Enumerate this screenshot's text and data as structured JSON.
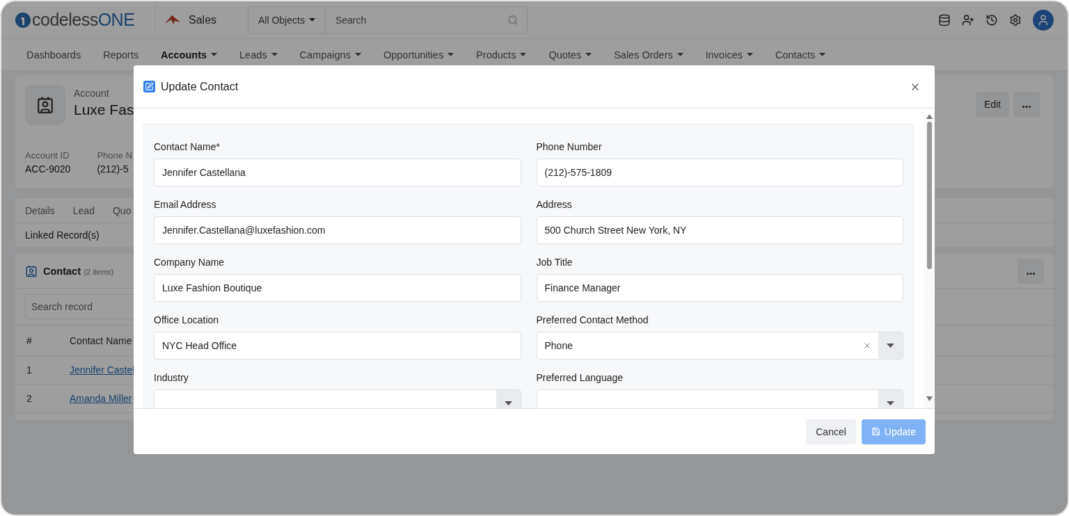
{
  "header": {
    "logo": {
      "text": "codeless",
      "accent": "ONE"
    },
    "app": "Sales",
    "search": {
      "scope": "All Objects",
      "placeholder": "Search"
    }
  },
  "nav": [
    {
      "label": "Dashboards",
      "dropdown": false,
      "selected": false
    },
    {
      "label": "Reports",
      "dropdown": false,
      "selected": false
    },
    {
      "label": "Accounts",
      "dropdown": true,
      "selected": true
    },
    {
      "label": "Leads",
      "dropdown": true,
      "selected": false
    },
    {
      "label": "Campaigns",
      "dropdown": true,
      "selected": false
    },
    {
      "label": "Opportunities",
      "dropdown": true,
      "selected": false
    },
    {
      "label": "Products",
      "dropdown": true,
      "selected": false
    },
    {
      "label": "Quotes",
      "dropdown": true,
      "selected": false
    },
    {
      "label": "Sales Orders",
      "dropdown": true,
      "selected": false
    },
    {
      "label": "Invoices",
      "dropdown": true,
      "selected": false
    },
    {
      "label": "Contacts",
      "dropdown": true,
      "selected": false
    }
  ],
  "account": {
    "label": "Account",
    "name": "Luxe Fas",
    "edit": "Edit",
    "fields": [
      {
        "label": "Account ID",
        "value": "ACC-9020"
      },
      {
        "label": "Phone N",
        "value": "(212)-5"
      }
    ]
  },
  "tabs": [
    {
      "label": "Details",
      "selected": false
    },
    {
      "label": "Lead",
      "selected": false
    },
    {
      "label": "Quo",
      "selected": false
    }
  ],
  "linked": "Linked Record(s)",
  "contacts": {
    "title": "Contact",
    "count": "(2 items)",
    "search_placeholder": "Search record",
    "columns": [
      "#",
      "Contact Name"
    ],
    "rows": [
      {
        "num": "1",
        "name": "Jennifer Castel"
      },
      {
        "num": "2",
        "name": "Amanda Miller"
      }
    ]
  },
  "modal": {
    "title": "Update Contact",
    "fields": [
      {
        "kind": "text",
        "label": "Contact Name*",
        "value": "Jennifer Castellana"
      },
      {
        "kind": "text",
        "label": "Phone Number",
        "value": "(212)-575-1809"
      },
      {
        "kind": "text",
        "label": "Email Address",
        "value": "Jennifer.Castellana@luxefashion.com"
      },
      {
        "kind": "text",
        "label": "Address",
        "value": "500 Church Street New York, NY"
      },
      {
        "kind": "text",
        "label": "Company Name",
        "value": "Luxe Fashion Boutique"
      },
      {
        "kind": "text",
        "label": "Job Title",
        "value": "Finance Manager"
      },
      {
        "kind": "text",
        "label": "Office Location",
        "value": "NYC Head Office"
      },
      {
        "kind": "select",
        "label": "Preferred Contact Method",
        "value": "Phone",
        "clearable": true
      },
      {
        "kind": "select",
        "label": "Industry",
        "clearable": false
      },
      {
        "kind": "select",
        "label": "Preferred Language",
        "clearable": false
      }
    ],
    "buttons": [
      {
        "kind": "secondary",
        "label": "Cancel",
        "disabled": false
      },
      {
        "kind": "primary",
        "label": "Update",
        "disabled": true
      }
    ]
  }
}
